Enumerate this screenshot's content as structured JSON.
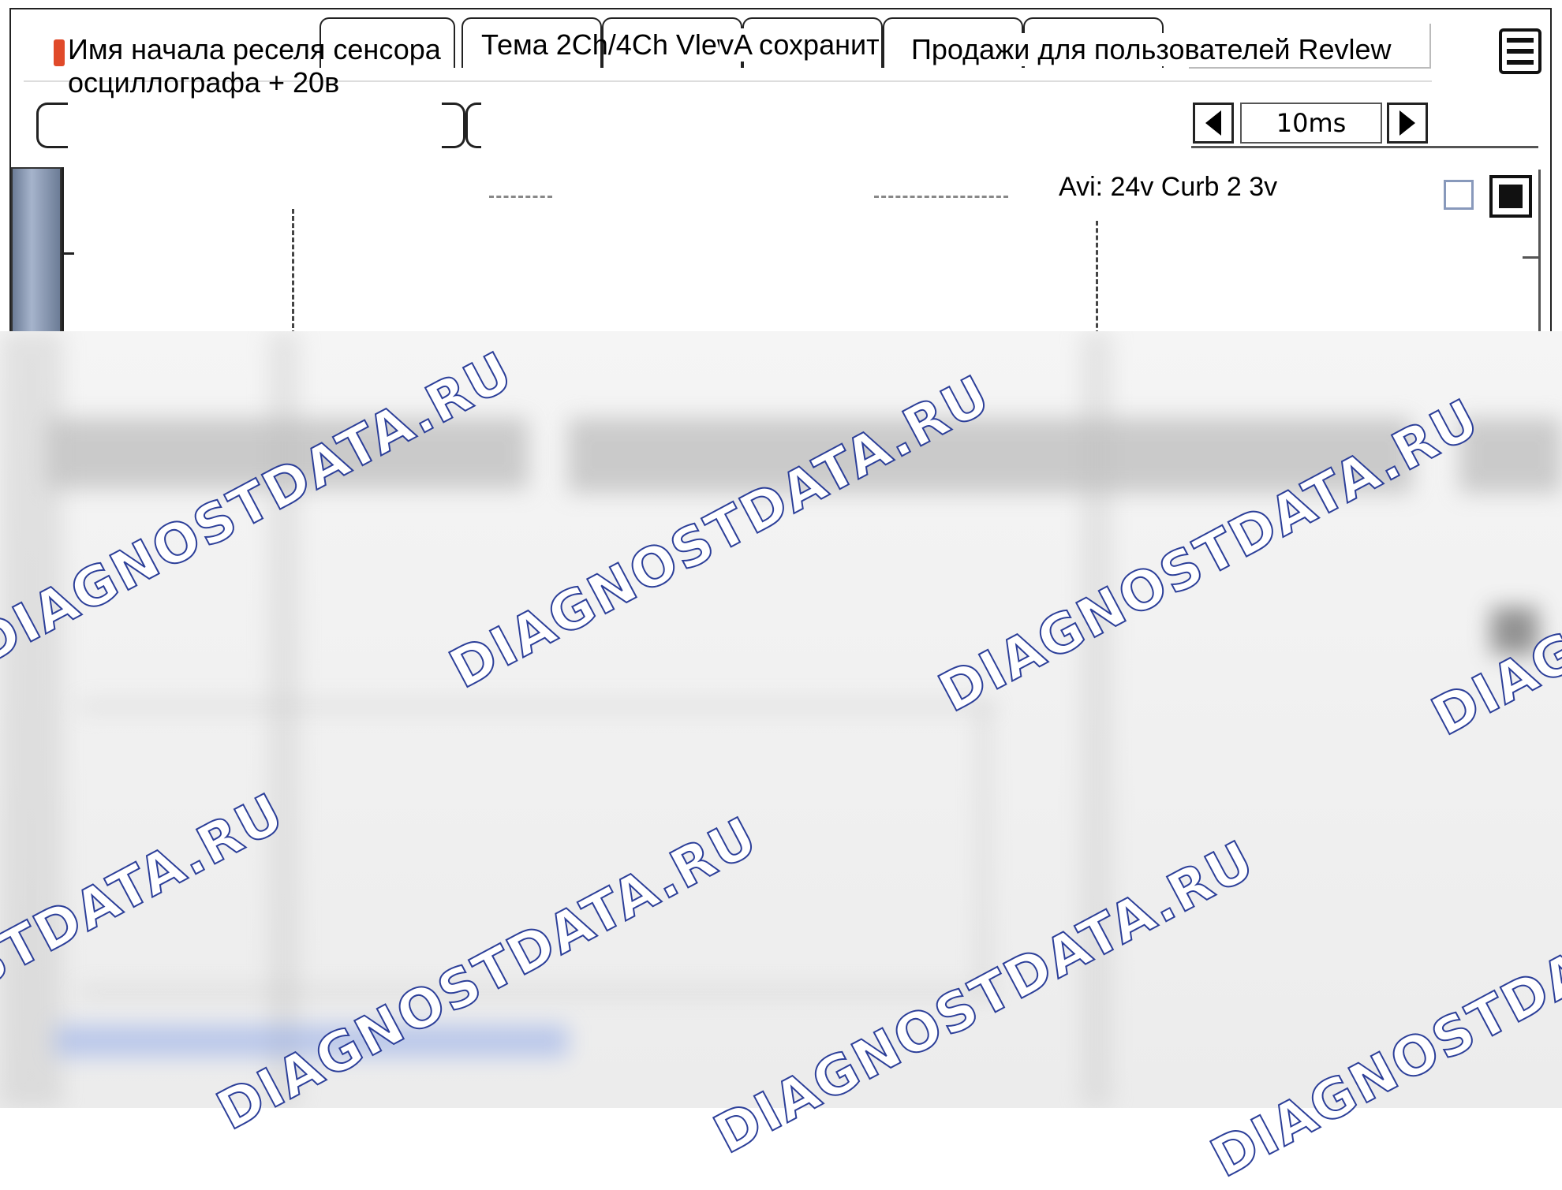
{
  "tabs": {
    "sensor_name": "Имя начала реселя сенсора",
    "sensor_subtitle": "осциллографа + 20в",
    "theme_view": "Тема 2Ch/4Ch Vlew",
    "save": "vA сохранит",
    "sales": "Продажи для пользователей Revlew"
  },
  "toolbar": {
    "timebase_value": "10ms",
    "prev_icon": "left-triangle-icon",
    "next_icon": "right-triangle-icon",
    "menu_icon": "hamburger-menu-icon"
  },
  "scope": {
    "readout": "Avi: 24v Curb 2 3v"
  },
  "watermark": {
    "text": "DIAGNOSTDATA.RU",
    "color": "#2c3f99"
  }
}
